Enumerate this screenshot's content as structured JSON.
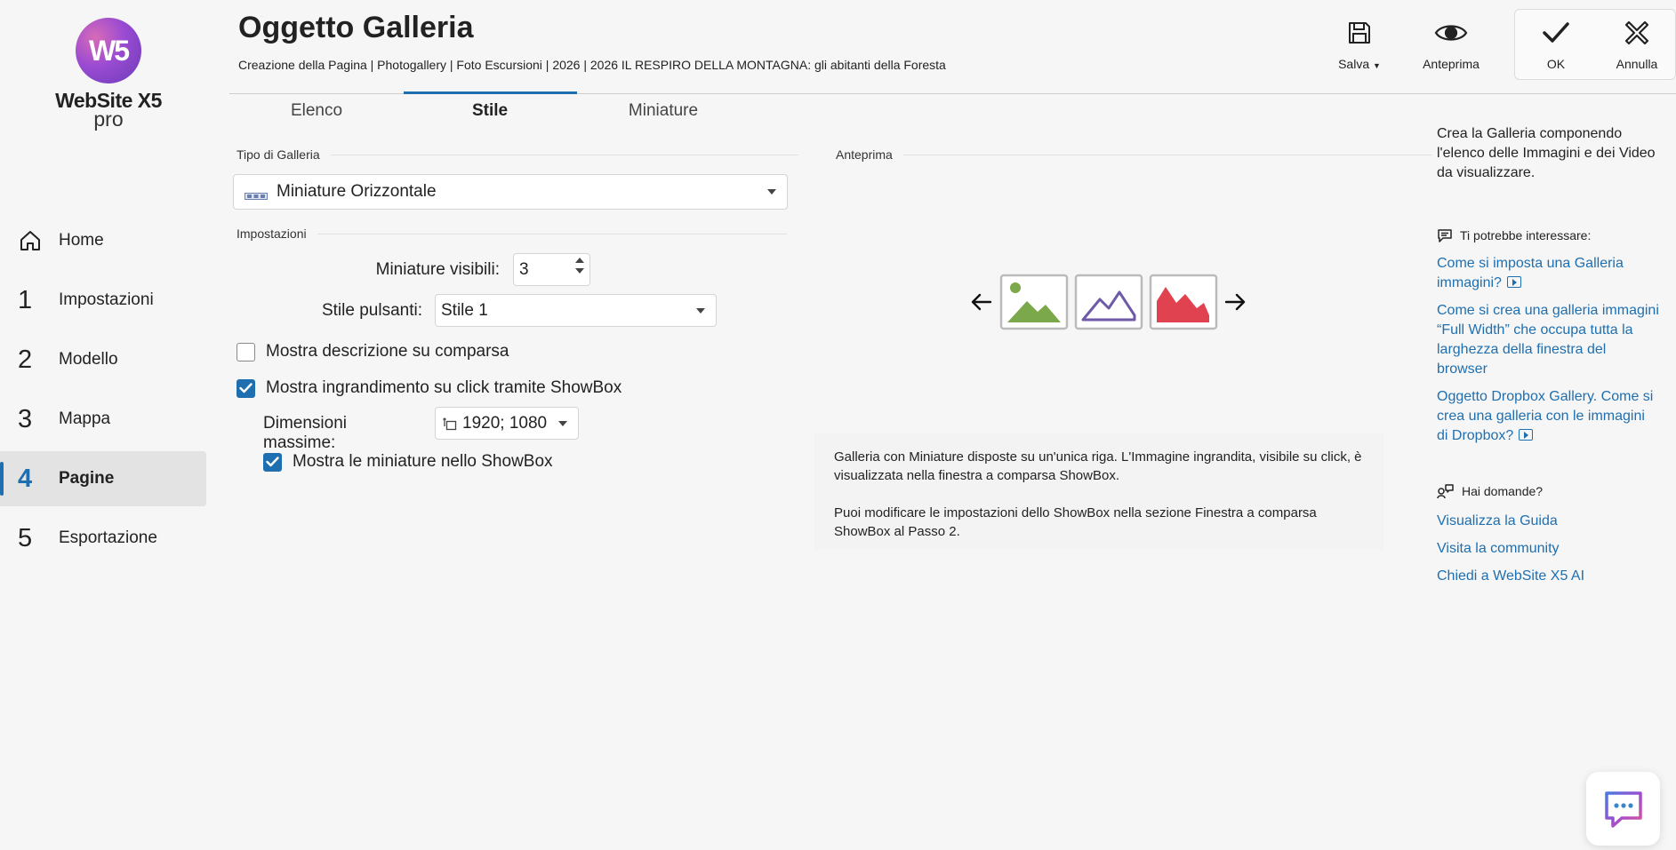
{
  "app": {
    "logo_mark": "W5",
    "logo_name": "WebSite X5",
    "logo_edition": "pro"
  },
  "sidebar": {
    "items": [
      {
        "num": "",
        "icon": "home-icon",
        "label": "Home"
      },
      {
        "num": "1",
        "label": "Impostazioni"
      },
      {
        "num": "2",
        "label": "Modello"
      },
      {
        "num": "3",
        "label": "Mappa"
      },
      {
        "num": "4",
        "label": "Pagine",
        "active": true
      },
      {
        "num": "5",
        "label": "Esportazione"
      }
    ]
  },
  "header": {
    "title": "Oggetto Galleria",
    "breadcrumb": "Creazione della Pagina | Photogallery | Foto Escursioni | 2026 | 2026 IL RESPIRO DELLA MONTAGNA: gli abitanti della Foresta"
  },
  "toolbar": {
    "save_label": "Salva",
    "preview_label": "Anteprima",
    "ok_label": "OK",
    "cancel_label": "Annulla"
  },
  "tabs": [
    {
      "label": "Elenco"
    },
    {
      "label": "Stile",
      "active": true
    },
    {
      "label": "Miniature"
    }
  ],
  "form": {
    "gallery_type_heading": "Tipo di Galleria",
    "gallery_type_value": "Miniature Orizzontale",
    "settings_heading": "Impostazioni",
    "visible_thumbs_label": "Miniature visibili:",
    "visible_thumbs_value": "3",
    "button_style_label": "Stile pulsanti:",
    "button_style_value": "Stile 1",
    "show_desc_label": "Mostra descrizione su comparsa",
    "show_desc_checked": false,
    "show_zoom_label": "Mostra ingrandimento su click tramite ShowBox",
    "show_zoom_checked": true,
    "max_dim_label": "Dimensioni massime:",
    "max_dim_value": "1920; 1080",
    "show_thumbs_label": "Mostra le miniature nello ShowBox",
    "show_thumbs_checked": true
  },
  "preview": {
    "heading": "Anteprima",
    "desc_p1": "Galleria con Miniature disposte su un'unica riga. L'Immagine ingrandita, visibile su click, è visualizzata nella finestra a comparsa ShowBox.",
    "desc_p2": "Puoi modificare le impostazioni dello ShowBox nella sezione Finestra a comparsa ShowBox al Passo 2."
  },
  "help": {
    "intro": "Crea la Galleria componendo l'elenco delle Immagini e dei Video da visualizzare.",
    "related_heading": "Ti potrebbe interessare:",
    "related_links": [
      "Come si imposta una Galleria immagini?",
      "Come si crea una galleria immagini “Full Width” che occupa tutta la larghezza della finestra del browser",
      "Oggetto Dropbox Gallery. Come si crea una galleria con le immagini di Dropbox?"
    ],
    "questions_heading": "Hai domande?",
    "question_links": [
      "Visualizza la Guida",
      "Visita la community",
      "Chiedi a WebSite X5 AI"
    ]
  },
  "colors": {
    "accent": "#1f6fb0",
    "thumb_green": "#7aa84a",
    "thumb_purple": "#6e5aa6",
    "thumb_red": "#e0424f"
  }
}
